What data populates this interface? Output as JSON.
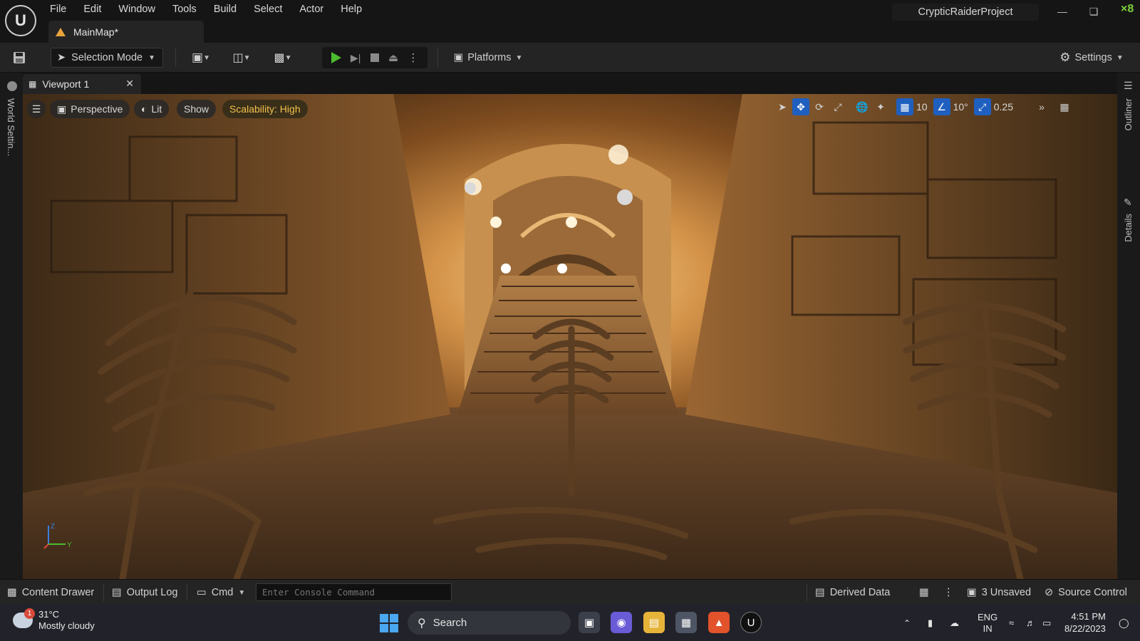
{
  "menu": [
    "File",
    "Edit",
    "Window",
    "Tools",
    "Build",
    "Select",
    "Actor",
    "Help"
  ],
  "document_tab": {
    "label": "MainMap*"
  },
  "project_name": "CrypticRaiderProject",
  "fps_indicator": "×8",
  "toolbar": {
    "selection_mode": "Selection Mode",
    "platforms": "Platforms",
    "settings": "Settings"
  },
  "left_panel": {
    "label": "World Settin..."
  },
  "right_panel": {
    "outliner": "Outliner",
    "details": "Details"
  },
  "viewport": {
    "tab_label": "Viewport 1",
    "view_mode": "Perspective",
    "lighting": "Lit",
    "show": "Show",
    "scalability": "Scalability: High",
    "grid_snap": "10",
    "rotation_snap": "10°",
    "scale_snap": "0.25",
    "axis_z": "Z",
    "axis_y": "Y"
  },
  "statusbar": {
    "content_drawer": "Content Drawer",
    "output_log": "Output Log",
    "cmd": "Cmd",
    "console_placeholder": "Enter Console Command",
    "derived_data": "Derived Data",
    "unsaved": "3 Unsaved",
    "source_control": "Source Control"
  },
  "taskbar": {
    "weather_badge": "1",
    "temperature": "31°C",
    "condition": "Mostly cloudy",
    "search": "Search",
    "language": "ENG",
    "region": "IN",
    "time": "4:51 PM",
    "date": "8/22/2023"
  },
  "colors": {
    "accent_blue": "#1f5fbf",
    "play_green": "#4dbd2f",
    "scalability_text": "#f2c14a",
    "warning_orange": "#e8a33c"
  }
}
